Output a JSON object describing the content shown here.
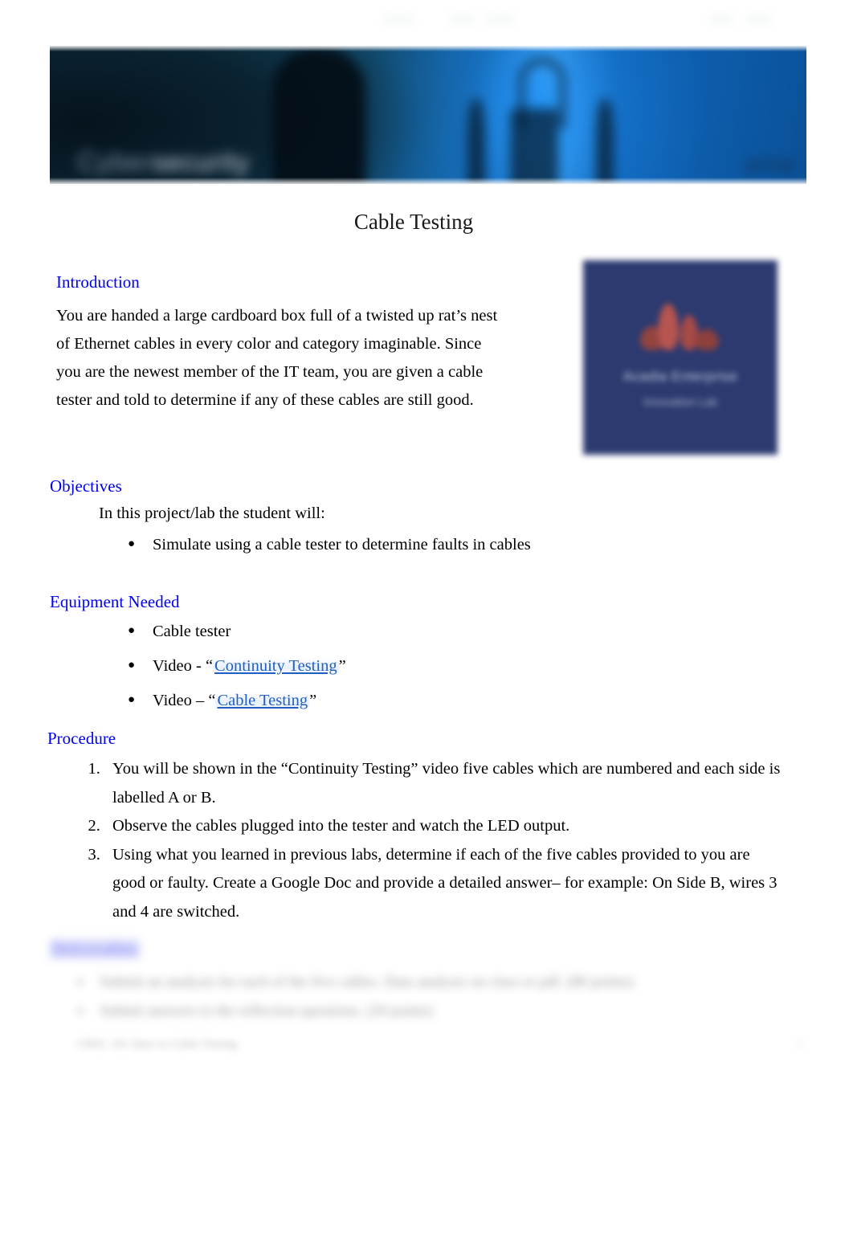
{
  "document": {
    "title": "Cable Testing"
  },
  "banner": {
    "word_primary": "Cyber",
    "word_secondary": "security",
    "right_text": "group"
  },
  "logo_card": {
    "line1": "Acadia Enterprise",
    "line2": "Innovation Lab"
  },
  "sections": {
    "introduction": {
      "heading": "Introduction",
      "body": "You are handed a large cardboard box full of a twisted up rat’s nest of Ethernet cables in every color and category imaginable. Since you are the newest member of the IT team, you are given a cable tester and told to determine if any of these cables are still good."
    },
    "objectives": {
      "heading": "Objectives",
      "lead": "In this project/lab the student will:",
      "items": [
        "Simulate using a cable tester to determine faults in cables"
      ]
    },
    "equipment": {
      "heading": "Equipment Needed",
      "items": [
        {
          "prefix": "Cable tester",
          "link": "",
          "suffix": ""
        },
        {
          "prefix": "Video - “",
          "link": "Continuity Testing",
          "suffix": "”"
        },
        {
          "prefix": "Video – “",
          "link": "Cable Testing",
          "suffix": "”"
        }
      ]
    },
    "procedure": {
      "heading": "Procedure",
      "steps": [
        "You will be shown in the “Continuity Testing” video five cables which are numbered and each side is labelled A or B.",
        "Observe the cables plugged into the tester and watch the LED output.",
        "Using what you learned in previous labs, determine if each of the five cables provided to you are good or faulty. Create a Google Doc and provide a detailed answer– for example: On Side B, wires 3 and 4 are switched."
      ]
    },
    "deliverables_blurred": {
      "heading": "Deliverables",
      "items": [
        "Submit an analysis for each of the five cables. Data analysis on class or pdf. (80 points)",
        "Submit answers to the reflection questions. (20 points)"
      ]
    }
  },
  "footer_blurred": {
    "text": "CBSC 101 Intro to Cable Testing",
    "page_number": "1"
  },
  "colors": {
    "heading_blue": "#0000ee",
    "link_blue": "#1f5fc4",
    "logo_card_bg": "#2c3a70",
    "logo_mark": "#b2504c"
  }
}
